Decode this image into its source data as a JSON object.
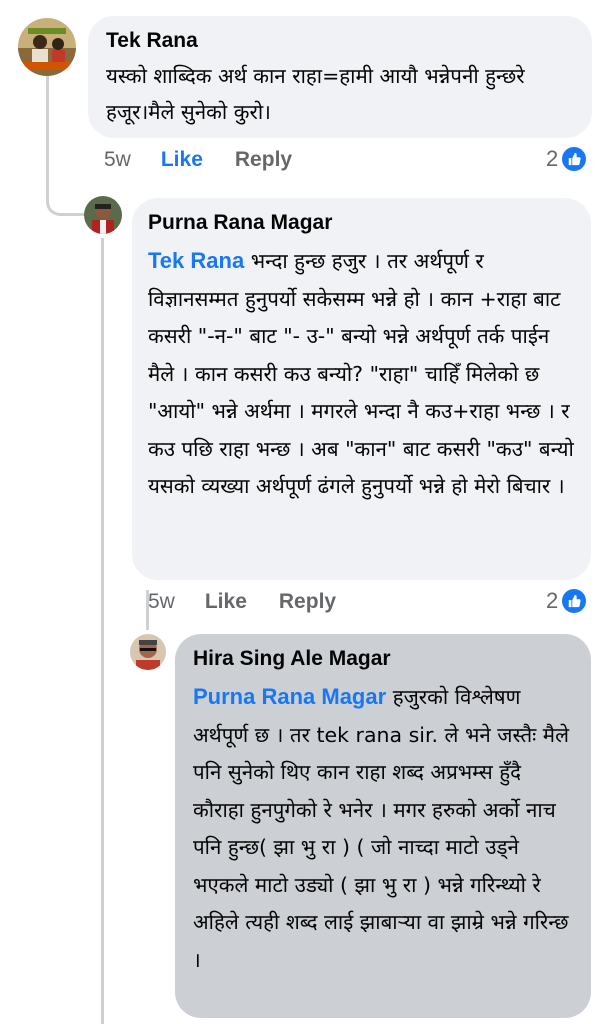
{
  "comments": [
    {
      "author": "Tek Rana",
      "text": "यस्को शाब्दिक अर्थ कान राहा=हामी आयौ भन्नेपनी हुन्छरे हजूर।मैले सुनेको कुरो।",
      "time": "5w",
      "like_label": "Like",
      "reply_label": "Reply",
      "reaction_count": "2",
      "reaction_icon": "like-icon"
    },
    {
      "author": "Purna Rana Magar",
      "mention": "Tek Rana",
      "text": " भन्दा हुन्छ हजुर । तर अर्थपूर्ण र विज्ञानसम्मत हुनुपर्यो सकेसम्म भन्ने हो । कान +राहा बाट कसरी \"-न-\" बाट \"- उ-\"  बन्यो भन्ने अर्थपूर्ण तर्क पाईन मैले ।  कान कसरी कउ बन्यो? \"राहा\" चाहिँ मिलेको छ \"आयो\" भन्ने अर्थमा । मगरले भन्दा नै कउ+राहा भन्छ । र कउ पछि राहा भन्छ । अब \"कान\" बाट कसरी \"कउ\" बन्यो यसको व्यख्या अर्थपूर्ण ढंगले हुनुपर्यो भन्ने हो मेरो बिचार ।",
      "time": "5w",
      "like_label": "Like",
      "reply_label": "Reply",
      "reaction_count": "2",
      "reaction_icon": "like-icon"
    },
    {
      "author": "Hira Sing Ale Magar",
      "mention": "Purna Rana Magar",
      "text": " हजुरको विश्लेषण अर्थपूर्ण छ । तर tek rana sir. ले भने जस्तैः मैले पनि सुनेको थिए कान राहा शब्द अप्रभम्स हुँदै कौराहा हुनपुगेको रे भनेर । मगर हरुको अर्को नाच पनि हुन्छ( झा भु रा ) ( जो नाच्दा माटो उड्ने भएकले माटो उड्यो ( झा भु रा  ) भन्ने गरिन्थ्यो रे अहिले त्यही शब्द लाई झाबाऱ्या वा झाम्रे भन्ने गरिन्छ ।"
    }
  ],
  "colors": {
    "bubble": "#f0f2f5",
    "bubble_highlight": "#ccd0d5",
    "link": "#1877f2",
    "meta": "#65676b"
  }
}
